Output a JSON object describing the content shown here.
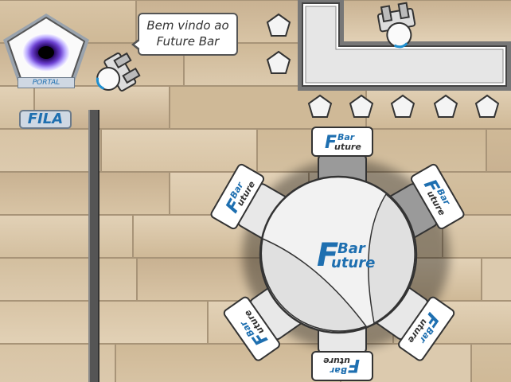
{
  "speech_bubble": {
    "line1": "Bem vindo ao",
    "line2": "Future Bar"
  },
  "portal": {
    "label": "PORTAL"
  },
  "queue": {
    "label": "FILA"
  },
  "logo": {
    "word1": "Bar",
    "word2": "uture",
    "initial": "F"
  },
  "colors": {
    "floor": "#d9c6a8",
    "accent": "#1e6fb0",
    "furniture": "#f0f0f0",
    "outline": "#333333"
  }
}
